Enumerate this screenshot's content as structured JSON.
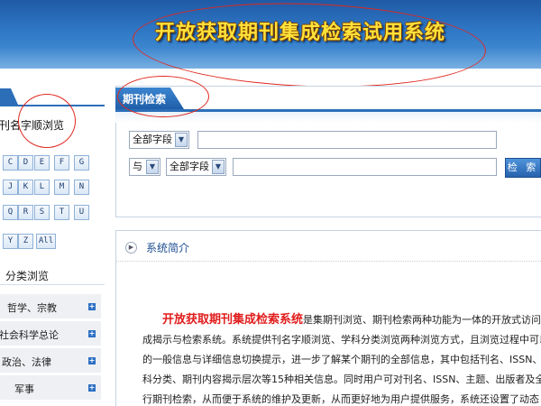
{
  "header": {
    "title": "开放获取期刊集成检索试用系统",
    "title_color": "#ffe23a",
    "bg_color": "#2f78c6"
  },
  "sidebar": {
    "section_title": "刊名字顺浏览",
    "letters": [
      "C",
      "D",
      "E",
      "F",
      "G",
      "J",
      "K",
      "L",
      "M",
      "N",
      "Q",
      "R",
      "S",
      "T",
      "U",
      "Y",
      "Z",
      "All"
    ],
    "category_heading": "分类浏览",
    "categories": [
      {
        "label": "哲学、宗教",
        "icon": "plus-icon"
      },
      {
        "label": "社会科学总论",
        "icon": "plus-icon"
      },
      {
        "label": "政治、法律",
        "icon": "plus-icon"
      },
      {
        "label": "军事",
        "icon": "plus-icon"
      }
    ]
  },
  "search": {
    "tab_label": "期刊检索",
    "field_select_1": "全部字段",
    "logic_select": "与",
    "field_select_2": "全部字段",
    "input_1_value": "",
    "input_2_value": "",
    "button_label": "检 索",
    "accent_color": "#2c6fb8"
  },
  "intro": {
    "heading": "系统简介",
    "highlight": "开放获取期刊集成检索系统",
    "line_1_rest": "是集期刊浏览、期刊检索两种功能为一体的开放式访问",
    "line_2": "成揭示与检索系统。系统提供刊名字顺浏览、学科分类浏览两种浏览方式，且浏览过程中可以",
    "line_3": "的一般信息与详细信息切换提示，进一步了解某个期刊的全部信息，其中包括刊名、ISSN、",
    "line_4": "科分类、期刊内容揭示层次等15种相关信息。同时用户可对刊名、ISSN、主题、出版者及全",
    "line_5": "行期刊检索，从而便于系统的维护及更新，从而更好地为用户提供服务，系统还设置了动态"
  },
  "annotation_color": "#e0281f"
}
